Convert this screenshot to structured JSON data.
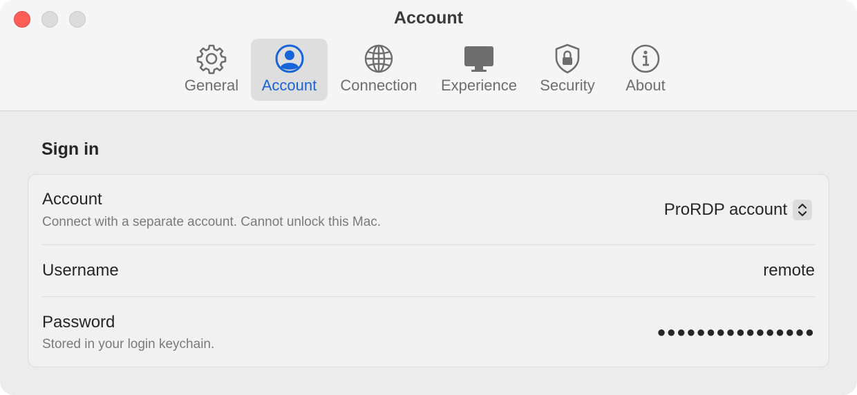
{
  "window": {
    "title": "Account"
  },
  "tabs": [
    {
      "label": "General",
      "icon": "gear-icon",
      "selected": false
    },
    {
      "label": "Account",
      "icon": "person-circle-icon",
      "selected": true
    },
    {
      "label": "Connection",
      "icon": "globe-icon",
      "selected": false
    },
    {
      "label": "Experience",
      "icon": "display-icon",
      "selected": false
    },
    {
      "label": "Security",
      "icon": "lock-shield-icon",
      "selected": false
    },
    {
      "label": "About",
      "icon": "info-icon",
      "selected": false
    }
  ],
  "colors": {
    "accent": "#1763d9",
    "close_button": "#fe5f57"
  },
  "section": {
    "title": "Sign in"
  },
  "rows": {
    "account": {
      "title": "Account",
      "subtitle": "Connect with a separate account. Cannot unlock this Mac.",
      "value": "ProRDP account"
    },
    "username": {
      "title": "Username",
      "value": "remote"
    },
    "password": {
      "title": "Password",
      "subtitle": "Stored in your login keychain.",
      "value": "●●●●●●●●●●●●●●●●"
    }
  }
}
